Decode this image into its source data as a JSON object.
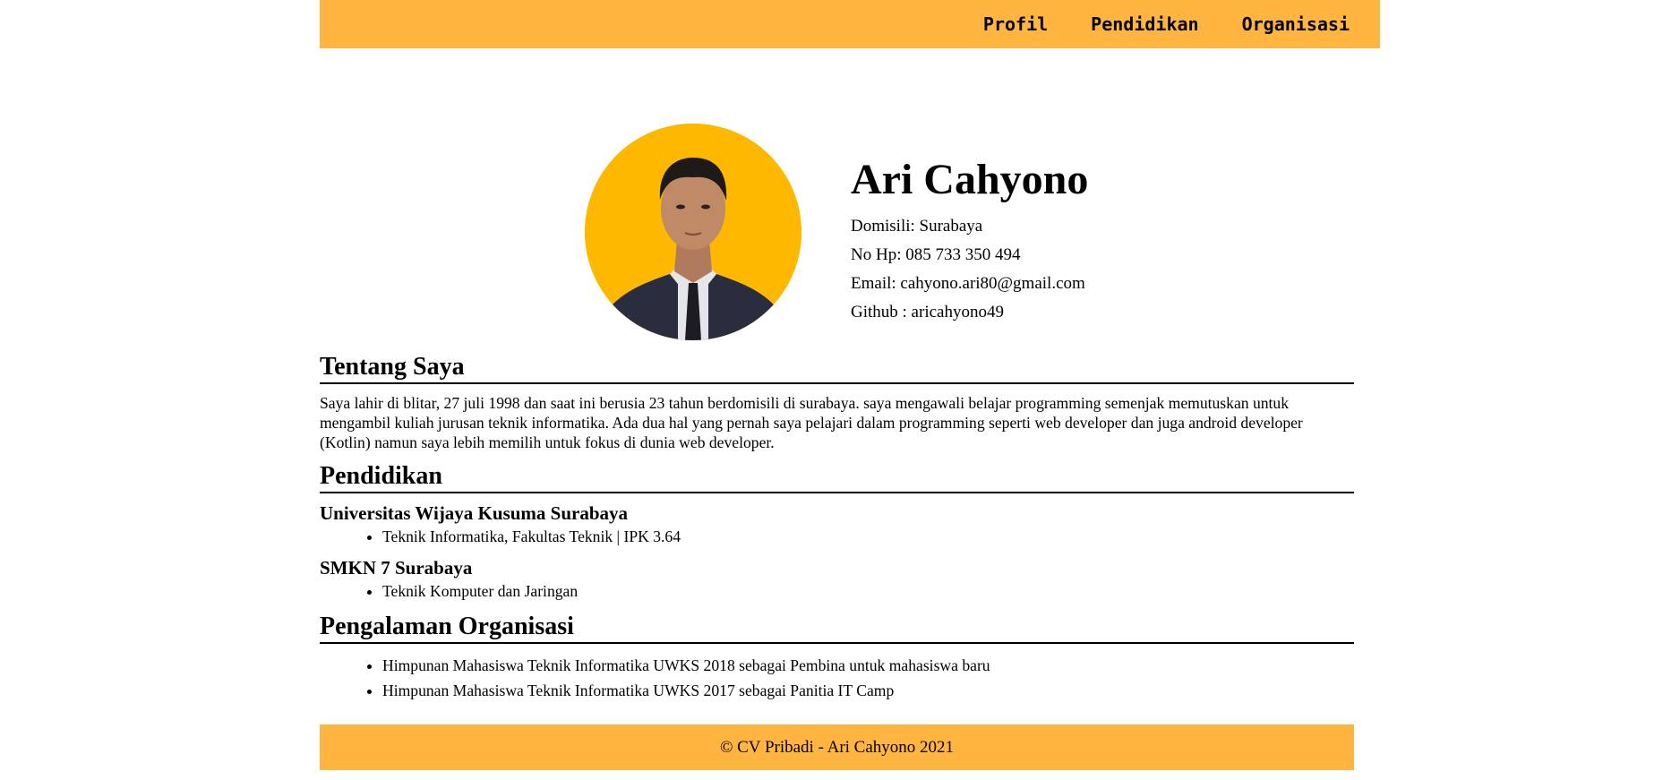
{
  "nav": {
    "items": [
      "Profil",
      "Pendidikan",
      "Organisasi"
    ]
  },
  "profile": {
    "name": "Ari Cahyono",
    "domisili": "Domisili: Surabaya",
    "phone": "No Hp: 085 733 350 494",
    "email": "Email: cahyono.ari80@gmail.com",
    "github": "Github : aricahyono49"
  },
  "about": {
    "title": "Tentang Saya",
    "text": "Saya lahir di blitar, 27 juli 1998 dan saat ini berusia 23 tahun berdomisili di surabaya. saya mengawali belajar programming semenjak memutuskan untuk mengambil kuliah jurusan teknik informatika. Ada dua hal yang pernah saya pelajari dalam programming seperti web developer dan juga android developer (Kotlin) namun saya lebih memilih untuk fokus di dunia web developer."
  },
  "education": {
    "title": "Pendidikan",
    "schools": [
      {
        "name": "Universitas Wijaya Kusuma Surabaya",
        "detail": "Teknik Informatika, Fakultas Teknik | IPK 3.64"
      },
      {
        "name": "SMKN 7 Surabaya",
        "detail": "Teknik Komputer dan Jaringan"
      }
    ]
  },
  "organization": {
    "title": "Pengalaman Organisasi",
    "items": [
      "Himpunan Mahasiswa Teknik Informatika UWKS 2018 sebagai Pembina untuk mahasiswa baru",
      "Himpunan Mahasiswa Teknik Informatika UWKS 2017 sebagai Panitia IT Camp"
    ]
  },
  "footer": {
    "text": "© CV Pribadi - Ari Cahyono 2021"
  },
  "colors": {
    "accent": "#ffb53f",
    "photo_bg": "#ffb800"
  }
}
